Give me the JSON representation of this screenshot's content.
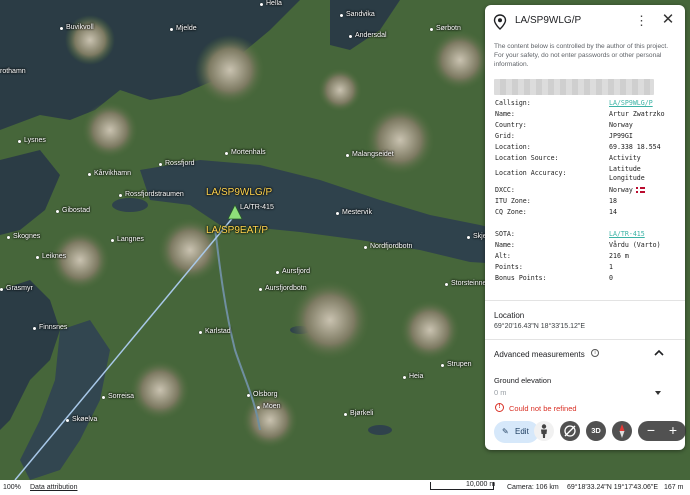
{
  "panel": {
    "title": "LA/SP9WLG/P",
    "more_icon": "more-vert-icon",
    "close_icon": "close-icon",
    "notice": "The content below is controlled by the author of this project. For your safety, do not enter passwords or other personal information.",
    "info": [
      {
        "key": "Callsign:",
        "value": "LA/SP9WLG/P",
        "link": true
      },
      {
        "key": "Name:",
        "value": "Artur Zwatrzko"
      },
      {
        "key": "Country:",
        "value": "Norway"
      },
      {
        "key": "Grid:",
        "value": "JP99GI"
      },
      {
        "key": "Location:",
        "value": "69.338 18.554"
      },
      {
        "key": "Location Source:",
        "value": "Activity"
      },
      {
        "key": "Location Accuracy:",
        "value": "Latitude",
        "value2": "Longitude"
      },
      {
        "key": "DXCC:",
        "value": "Norway"
      },
      {
        "key": "ITU Zone:",
        "value": "18"
      },
      {
        "key": "CQ Zone:",
        "value": "14"
      },
      {
        "key": "SOTA:",
        "value": "LA/TR-415",
        "link": true
      },
      {
        "key": "Name:",
        "value": "Vårdu (Varto)"
      },
      {
        "key": "Alt:",
        "value": "216 m"
      },
      {
        "key": "Points:",
        "value": "1"
      },
      {
        "key": "Bonus Points:",
        "value": "0"
      }
    ],
    "location_title": "Location",
    "location_value": "69°20'16.43\"N 18°33'15.12\"E",
    "advanced_title": "Advanced measurements",
    "ground_elevation_title": "Ground elevation",
    "ground_elevation_value": "0 m",
    "error_text": "Could not be refined",
    "edit_label": "Edit"
  },
  "map": {
    "labels": {
      "callsign_1": "LA/SP9WLG/P",
      "callsign_2": "LA/SP9EAT/P",
      "summit": "LA/TR-415"
    },
    "places": [
      {
        "name": "Buvikvoll"
      },
      {
        "name": "Mjelde"
      },
      {
        "name": "Hella"
      },
      {
        "name": "Sandvika"
      },
      {
        "name": "Andersdal"
      },
      {
        "name": "Sørbotn"
      },
      {
        "name": "rothamn"
      },
      {
        "name": "Lysnes"
      },
      {
        "name": "Kårvikhamn"
      },
      {
        "name": "Rossfjord"
      },
      {
        "name": "Mortenhals"
      },
      {
        "name": "Malangseidet"
      },
      {
        "name": "Rossfjordstraumen"
      },
      {
        "name": "Gibostad"
      },
      {
        "name": "Mestervik"
      },
      {
        "name": "Skognes"
      },
      {
        "name": "Langnes"
      },
      {
        "name": "Nordfjordbotn"
      },
      {
        "name": "Leiknes"
      },
      {
        "name": "Aursfjord"
      },
      {
        "name": "Grasmyr"
      },
      {
        "name": "Aursfjordbotn"
      },
      {
        "name": "Finnsnes"
      },
      {
        "name": "Karlstad"
      },
      {
        "name": "Sorreisa"
      },
      {
        "name": "Olsborg"
      },
      {
        "name": "Moen"
      },
      {
        "name": "Skøelva"
      },
      {
        "name": "Bjørkeli"
      },
      {
        "name": "Heia"
      },
      {
        "name": "Strupen"
      },
      {
        "name": "Storsteinnes"
      },
      {
        "name": "Skjer"
      }
    ],
    "controls": {
      "person_icon": "pegman-icon",
      "tilt_icon": "tilt-icon",
      "three_d_label": "3D",
      "compass_icon": "compass-icon",
      "zoom_out": "−",
      "zoom_in": "+"
    },
    "colors": {
      "water": "#2b3c45",
      "land": "#4a6b3a",
      "line": "#a8c8e8",
      "label_yellow": "#ffd34d",
      "marker_green": "#8fe07a"
    }
  },
  "status_bar": {
    "zoom_pct": "100%",
    "attribution": "Data attribution",
    "scale": "10,000 m",
    "camera": "Camera: 106 km",
    "coords": "69°18'33.24\"N 19°17'43.06\"E",
    "altitude": "167 m"
  }
}
